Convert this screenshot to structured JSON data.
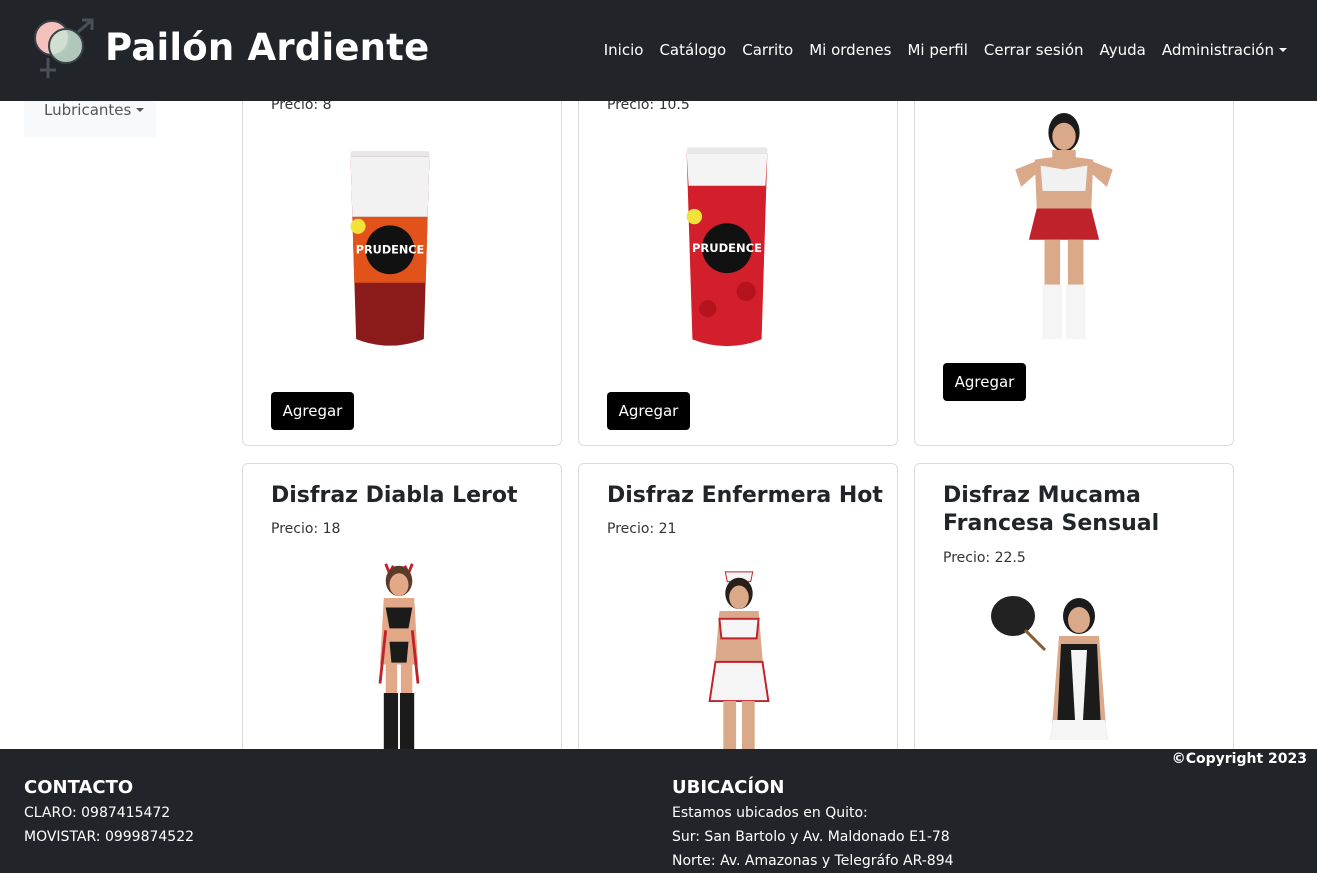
{
  "brand": {
    "name": "Pailón Ardiente",
    "logo_icon": "gender-symbols-icon"
  },
  "nav": {
    "items": [
      "Inicio",
      "Catálogo",
      "Carrito",
      "Mi ordenes",
      "Mi perfil",
      "Cerrar sesión",
      "Ayuda"
    ],
    "admin_label": "Administración"
  },
  "sidebar": {
    "category_label": "Lubricantes"
  },
  "products": [
    {
      "title": "",
      "price": "Precio: 8",
      "button": "Agregar",
      "image": "prudence-fire-gel-tube"
    },
    {
      "title": "",
      "price": "Precio: 10.5",
      "button": "Agregar",
      "image": "prudence-strawberry-gel-tube"
    },
    {
      "title": "",
      "price": "",
      "button": "Agregar",
      "image": "schoolgirl-costume-photo"
    },
    {
      "title": "Disfraz Diabla Lerot",
      "price": "Precio: 18",
      "button": "",
      "image": "devil-costume-photo"
    },
    {
      "title": "Disfraz Enfermera Hot",
      "price": "Precio: 21",
      "button": "",
      "image": "nurse-costume-photo"
    },
    {
      "title": "Disfraz Mucama Francesa Sensual",
      "price": "Precio: 22.5",
      "button": "",
      "image": "maid-costume-photo"
    }
  ],
  "footer": {
    "copyright": "©Copyright 2023",
    "contact": {
      "heading": "CONTACTO",
      "lines": [
        "CLARO: 0987415472",
        "MOVISTAR: 0999874522"
      ]
    },
    "location": {
      "heading": "UBICACÍON",
      "lines": [
        "Estamos ubicados en Quito:",
        "Sur: San Bartolo y Av. Maldonado E1-78",
        "Norte: Av. Amazonas y Telegráfo AR-894"
      ]
    }
  },
  "colors": {
    "navbar": "#212529",
    "button": "#000000",
    "sidebar_bg": "#f8f9fa"
  }
}
